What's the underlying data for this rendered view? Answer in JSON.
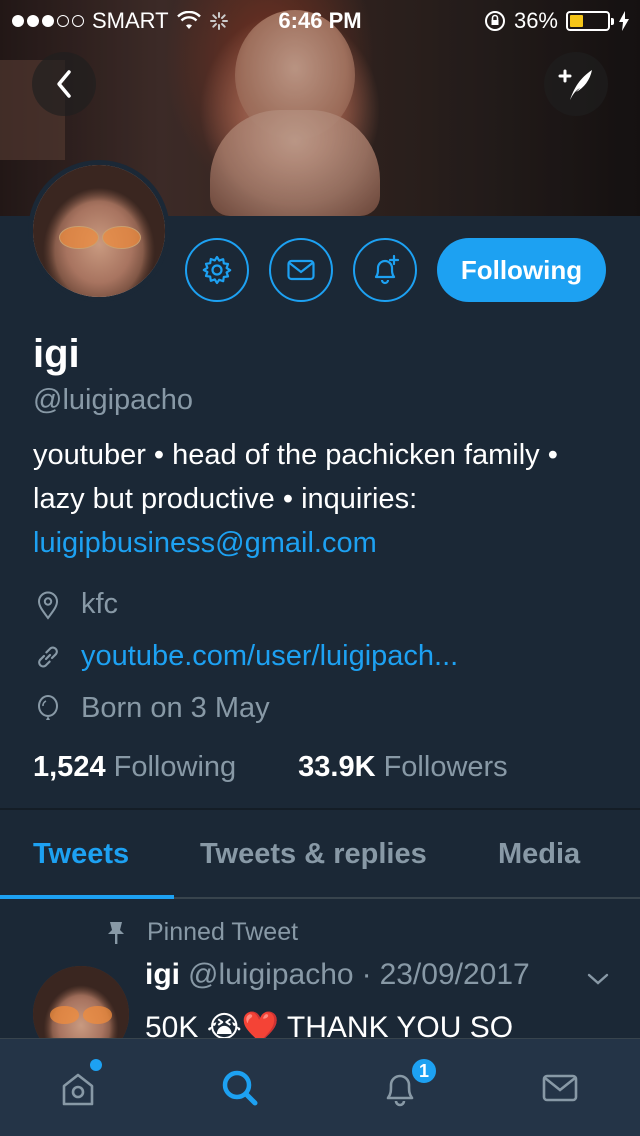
{
  "status_bar": {
    "carrier": "SMART",
    "time": "6:46 PM",
    "battery_percent": "36%",
    "battery_level": 0.36,
    "signal_bars": 3
  },
  "profile": {
    "name": "igi",
    "handle": "@luigipacho",
    "follow_button": "Following",
    "bio_text": "youtuber • head of the pachicken family • lazy but productive • inquiries: ",
    "bio_email": "luigipbusiness@gmail.com",
    "location": "kfc",
    "website": "youtube.com/user/luigipach...",
    "birthday": "Born on 3 May",
    "following_count": "1,524",
    "following_label": "Following",
    "followers_count": "33.9K",
    "followers_label": "Followers"
  },
  "tabs": [
    {
      "label": "Tweets",
      "active": true
    },
    {
      "label": "Tweets & replies",
      "active": false
    },
    {
      "label": "Media",
      "active": false
    }
  ],
  "pinned_tweet": {
    "label": "Pinned Tweet",
    "name": "igi",
    "handle": "@luigipacho",
    "separator": "·",
    "date": "23/09/2017",
    "text": "50K 😭❤️ THANK YOU SO"
  },
  "bottom_nav": {
    "notification_badge": "1",
    "items": [
      "home-icon",
      "search-icon",
      "notifications-icon",
      "messages-icon"
    ]
  },
  "colors": {
    "accent": "#1da1f2",
    "background": "#1b2836",
    "tabbar": "#243447",
    "secondary_text": "#8899a6"
  }
}
